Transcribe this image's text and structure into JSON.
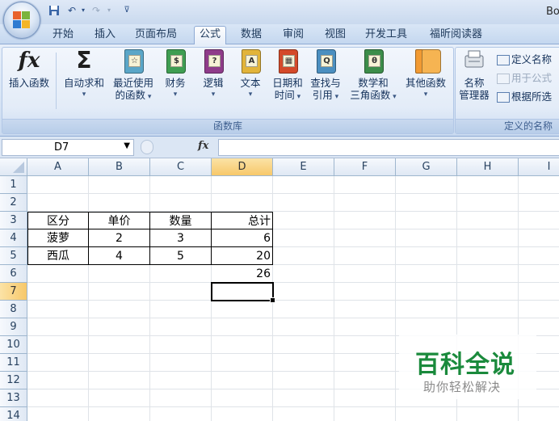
{
  "window": {
    "title": "Bo"
  },
  "tabs": [
    "开始",
    "插入",
    "页面布局",
    "公式",
    "数据",
    "审阅",
    "视图",
    "开发工具",
    "福昕阅读器"
  ],
  "active_tab": "公式",
  "ribbon": {
    "function_library": {
      "label": "函数库",
      "insert_function": {
        "line1": "插入函数"
      },
      "autosum": {
        "line1": "自动求和"
      },
      "recent": {
        "line1": "最近使用",
        "line2": "的函数"
      },
      "financial": {
        "line1": "财务"
      },
      "logical": {
        "line1": "逻辑"
      },
      "text": {
        "line1": "文本"
      },
      "datetime": {
        "line1": "日期和",
        "line2": "时间"
      },
      "lookup": {
        "line1": "查找与",
        "line2": "引用"
      },
      "math": {
        "line1": "数学和",
        "line2": "三角函数"
      },
      "more": {
        "line1": "其他函数"
      },
      "icon_letters": {
        "recent": "☆",
        "financial": "$",
        "logical": "?",
        "text": "A",
        "datetime": "▦",
        "lookup": "Q",
        "math": "θ"
      },
      "colors": {
        "recent": "#5aa6c8",
        "financial": "#3f9e52",
        "logical": "#8f3c8a",
        "text": "#e2b43a",
        "datetime": "#d44a2a",
        "lookup": "#4b8fc0",
        "math": "#3c8d4a",
        "more": "#f29a32"
      }
    },
    "defined_names": {
      "label": "定义的名称",
      "name_manager": {
        "line1": "名称",
        "line2": "管理器"
      },
      "define_name": "定义名称",
      "use_in_formula": "用于公式",
      "create_from_selection": "根据所选"
    }
  },
  "formula_bar": {
    "name_box": "D7",
    "fx": "fx",
    "content": ""
  },
  "columns": [
    "A",
    "B",
    "C",
    "D",
    "E",
    "F",
    "G",
    "H",
    "I"
  ],
  "selected_column": "D",
  "rows": [
    "1",
    "2",
    "3",
    "4",
    "5",
    "6",
    "7",
    "8",
    "9",
    "10",
    "11",
    "12",
    "13",
    "14"
  ],
  "selected_row": "7",
  "cells": {
    "A3": "区分",
    "B3": "单价",
    "C3": "数量",
    "D3": "总计",
    "A4": "菠萝",
    "B4": "2",
    "C4": "3",
    "D4": "6",
    "A5": "西瓜",
    "B5": "4",
    "C5": "5",
    "D5": "20",
    "D6": "26"
  },
  "watermark": {
    "title": "百科全说",
    "subtitle": "助你轻松解决"
  }
}
